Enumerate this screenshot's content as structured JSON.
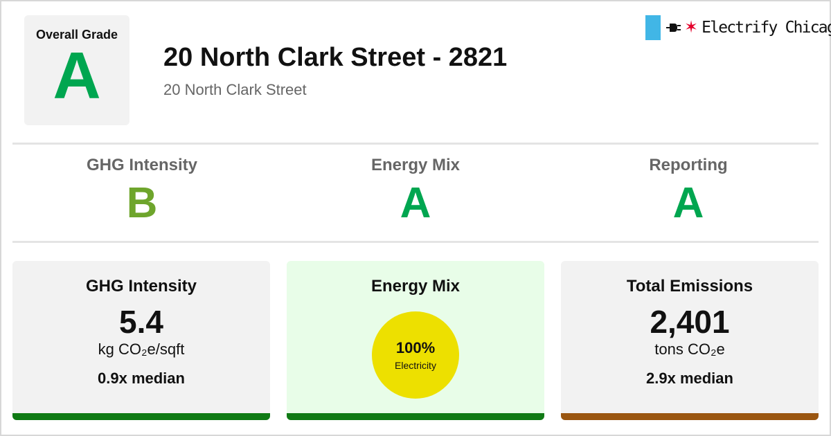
{
  "colors": {
    "grade_a": "#00a650",
    "grade_b": "#6ea52c",
    "bar_good": "#0f7a14",
    "bar_bad": "#9a5610",
    "electricity": "#ede000",
    "chicago_blue": "#41b6e6",
    "chicago_red": "#e4002b"
  },
  "overall": {
    "label": "Overall Grade",
    "grade": "A"
  },
  "building": {
    "title": "20 North Clark Street - 2821",
    "address": "20 North Clark Street"
  },
  "brand": {
    "name": "Electrify Chicago",
    "icons": [
      "plug-icon",
      "star-icon"
    ]
  },
  "subgrades": [
    {
      "label": "GHG Intensity",
      "grade": "B"
    },
    {
      "label": "Energy Mix",
      "grade": "A"
    },
    {
      "label": "Reporting",
      "grade": "A"
    }
  ],
  "cards": {
    "ghg": {
      "title": "GHG Intensity",
      "value": "5.4",
      "unit": "kg CO₂e/sqft",
      "median": "0.9x median"
    },
    "mix": {
      "title": "Energy Mix",
      "percent": "100%",
      "source": "Electricity"
    },
    "emissions": {
      "title": "Total Emissions",
      "value": "2,401",
      "unit": "tons CO₂e",
      "median": "2.9x median"
    }
  }
}
